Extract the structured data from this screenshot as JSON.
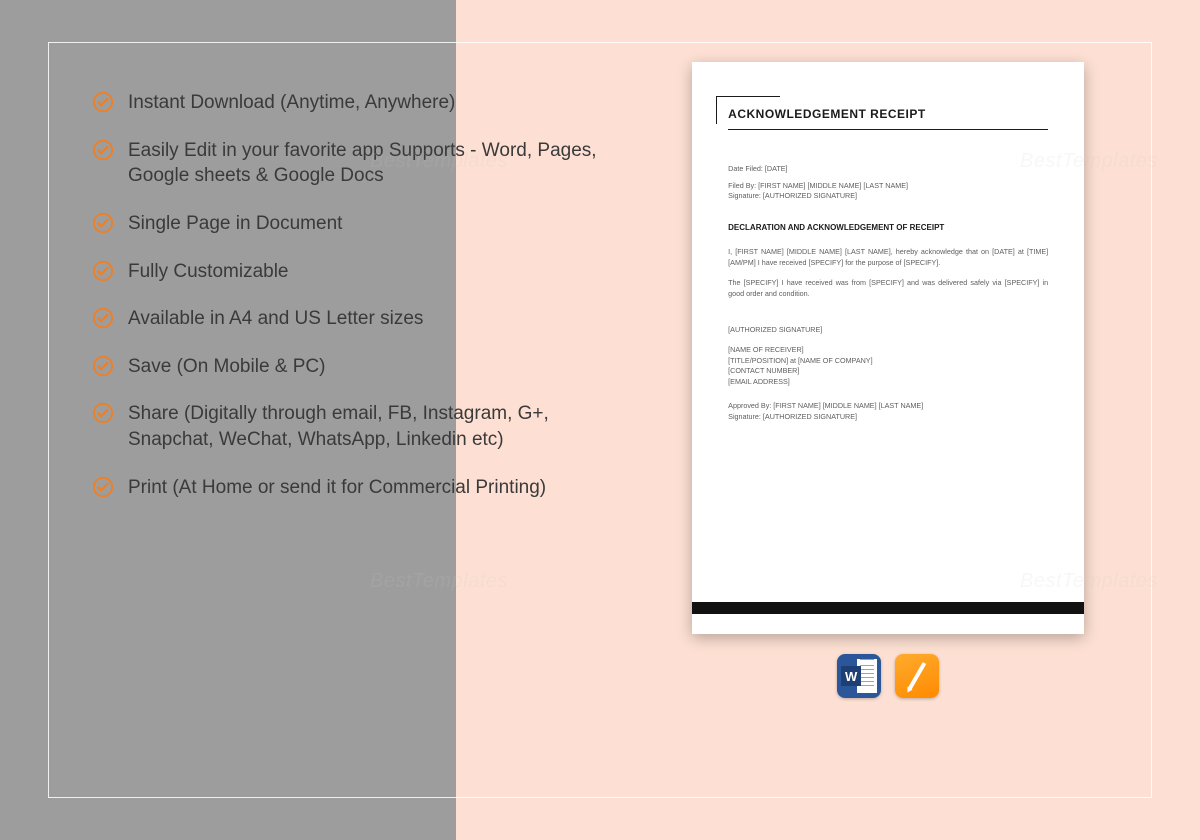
{
  "watermark": "BestTemplates",
  "features": [
    "Instant Download (Anytime, Anywhere)",
    "Easily Edit in your favorite app Supports - Word, Pages, Google sheets & Google Docs",
    "Single Page in Document",
    "Fully Customizable",
    "Available in A4 and US Letter sizes",
    "Save (On Mobile & PC)",
    "Share (Digitally through email, FB, Instagram, G+, Snapchat, WeChat, WhatsApp, Linkedin etc)",
    "Print (At Home or send it for Commercial Printing)"
  ],
  "colors": {
    "accent": "#f07f23"
  },
  "document": {
    "title": "ACKNOWLEDGEMENT RECEIPT",
    "date_filed": "Date Filed: [DATE]",
    "filed_by": "Filed By: [FIRST NAME] [MIDDLE NAME] [LAST NAME]",
    "signature_top": "Signature: [AUTHORIZED SIGNATURE]",
    "section_head": "DECLARATION AND ACKNOWLEDGEMENT OF RECEIPT",
    "para1": "I, [FIRST NAME] [MIDDLE NAME] [LAST NAME], hereby acknowledge that on [DATE] at [TIME] [AM/PM] I have received [SPECIFY] for the purpose of [SPECIFY].",
    "para2": "The [SPECIFY] I have received was from [SPECIFY] and was delivered safely via [SPECIFY] in good order and condition.",
    "auth_sig": "[AUTHORIZED SIGNATURE]",
    "receiver_name": "[NAME OF RECEIVER]",
    "receiver_title": "[TITLE/POSITION] at [NAME OF COMPANY]",
    "receiver_contact": "[CONTACT NUMBER]",
    "receiver_email": "[EMAIL ADDRESS]",
    "approved_by": "Approved By: [FIRST NAME] [MIDDLE NAME] [LAST NAME]",
    "signature_bottom": "Signature: [AUTHORIZED SIGNATURE]"
  },
  "apps": {
    "word_letter": "W"
  }
}
